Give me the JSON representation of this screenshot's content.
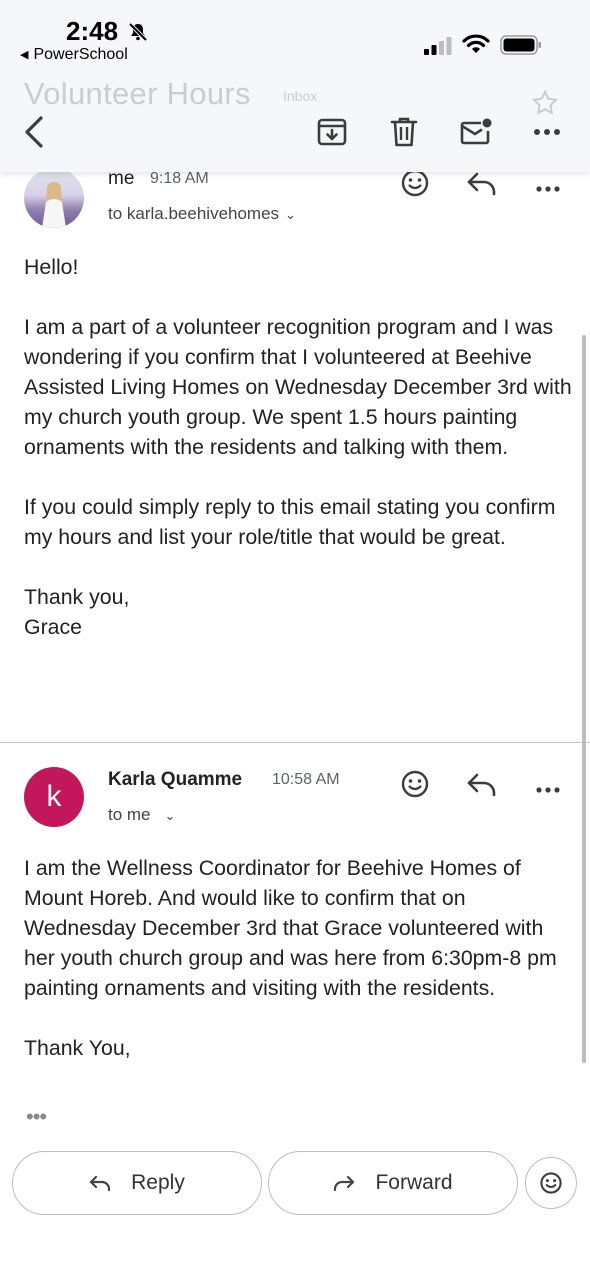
{
  "status_bar": {
    "time": "2:48",
    "back_app": "PowerSchool"
  },
  "header": {
    "subject": "Volunteer Hours",
    "label": "Inbox"
  },
  "toolbar": {
    "icons": [
      "back-arrow-icon",
      "archive-icon",
      "trash-icon",
      "mark-unread-icon",
      "more-icon"
    ]
  },
  "messages": [
    {
      "sender": "me",
      "time": "9:18 AM",
      "to": "to karla.beehivehomes",
      "paragraphs": [
        "Hello!",
        "I am a part of a volunteer recognition program and I was wondering if you confirm that I volunteered at Beehive Assisted Living Homes on Wednesday December 3rd with my church youth group. We spent 1.5 hours painting ornaments with the residents and talking with them.",
        "If you could simply reply to this email stating you confirm my hours and list your role/title that would be great.",
        "Thank you,\nGrace"
      ]
    },
    {
      "sender": "Karla Quamme",
      "avatar_letter": "k",
      "time": "10:58 AM",
      "to": "to me",
      "paragraphs": [
        "I am the Wellness Coordinator for Beehive Homes of Mount Horeb. And would like to confirm that on Wednesday December 3rd that Grace volunteered with her youth church group and was here from 6:30pm-8 pm painting ornaments and visiting with the residents.",
        "Thank You,"
      ],
      "trimmed_indicator": "•••"
    }
  ],
  "actions": {
    "reply": "Reply",
    "forward": "Forward"
  },
  "colors": {
    "avatar_k": "#c2185b",
    "header_bg": "#f5f7fa"
  }
}
